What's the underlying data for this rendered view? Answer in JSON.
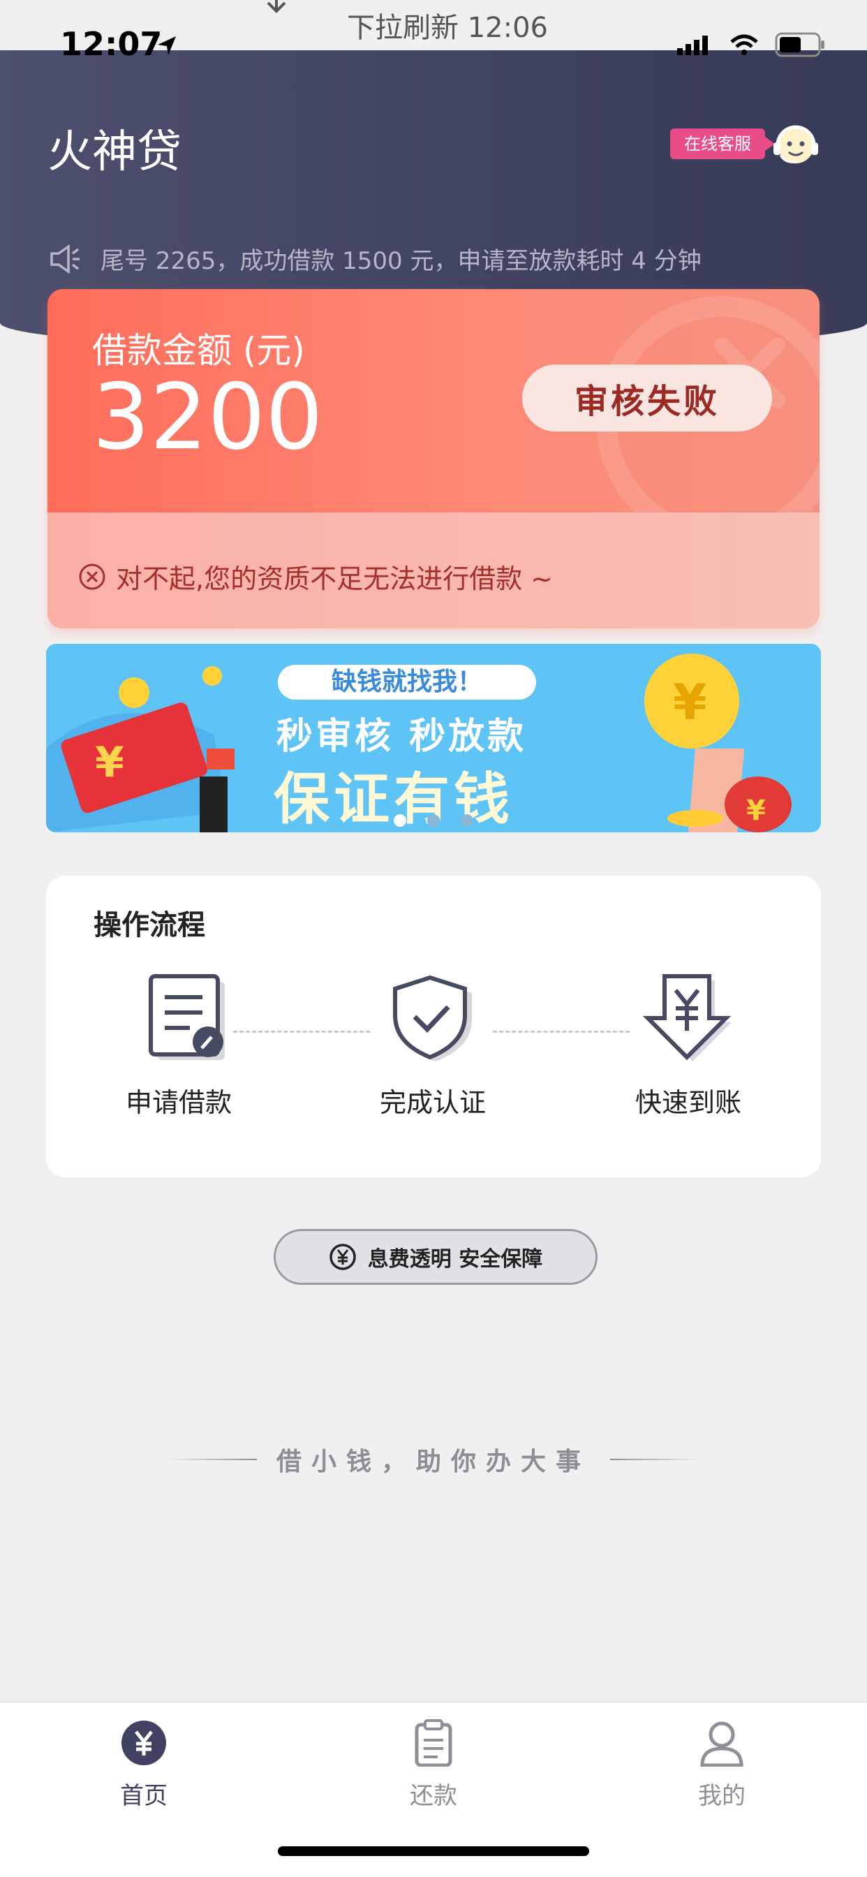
{
  "pull_refresh": {
    "text": "下拉刷新 12:06"
  },
  "status_bar": {
    "time": "12:07"
  },
  "header": {
    "app_title": "火神贷",
    "customer_service_label": "在线客服",
    "notice": "尾号 2265，成功借款 1500 元，申请至放款耗时 4 分钟"
  },
  "loan_card": {
    "label": "借款金额 (元)",
    "amount": "3200",
    "status": "审核失败",
    "message": "对不起,您的资质不足无法进行借款 ~"
  },
  "banner": {
    "tag": "缺钱就找我！",
    "line1": "秒审核  秒放款",
    "line2": "保证有钱",
    "dots": 3,
    "active_dot": 0
  },
  "process": {
    "title": "操作流程",
    "steps": [
      {
        "label": "申请借款",
        "icon": "document-edit-icon"
      },
      {
        "label": "完成认证",
        "icon": "shield-check-icon"
      },
      {
        "label": "快速到账",
        "icon": "yuan-download-icon"
      }
    ]
  },
  "guarantee": {
    "text": "息费透明 安全保障"
  },
  "slogan": {
    "text": "借小钱，助你办大事"
  },
  "tabbar": {
    "items": [
      {
        "label": "首页",
        "icon": "yuan-circle-icon",
        "active": true
      },
      {
        "label": "还款",
        "icon": "clipboard-icon",
        "active": false
      },
      {
        "label": "我的",
        "icon": "user-icon",
        "active": false
      }
    ]
  },
  "colors": {
    "header_bg": "#3f4260",
    "card_accent": "#ff6d5a",
    "status_text": "#9a2a23",
    "badge_pink": "#e84d88",
    "banner_blue": "#5ec3f5"
  }
}
